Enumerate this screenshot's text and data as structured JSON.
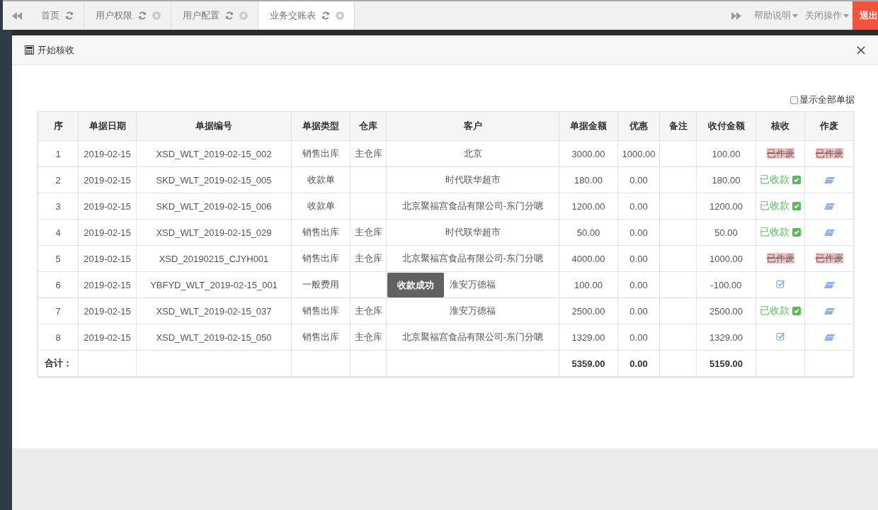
{
  "tabs": [
    {
      "label": "首页",
      "closable": false,
      "selected": false
    },
    {
      "label": "用户权限",
      "closable": true,
      "selected": false
    },
    {
      "label": "用户配置",
      "closable": true,
      "selected": false
    },
    {
      "label": "业务交账表",
      "closable": true,
      "selected": true
    }
  ],
  "top_menus": [
    "帮助说明",
    "关闭操作"
  ],
  "logout": "退出",
  "dialog": {
    "title": "开始核收",
    "show_all": {
      "label": "显示全部单据",
      "checked": false
    },
    "table": {
      "columns": [
        "序",
        "单据日期",
        "单据编号",
        "单据类型",
        "仓库",
        "客户",
        "单据金额",
        "优惠",
        "备注",
        "收付金额",
        "核收",
        "作废"
      ],
      "rows": [
        {
          "no": "1",
          "date": "2019-02-15",
          "code": "XSD_WLT_2019-02-15_002",
          "type": "销售出库",
          "warehouse": "主仓库",
          "customer": "北京",
          "amount": "3000.00",
          "discount": "1000.00",
          "paid": "100.00",
          "check": {
            "kind": "voided",
            "label": "已作废"
          },
          "void": {
            "kind": "voided",
            "label": "已作废"
          }
        },
        {
          "no": "2",
          "date": "2019-02-15",
          "code": "SKD_WLT_2019-02-15_005",
          "type": "收款单",
          "warehouse": "",
          "customer": "时代联华超市",
          "amount": "180.00",
          "discount": "0.00",
          "paid": "180.00",
          "check": {
            "kind": "received",
            "label": "已收款"
          },
          "void": {
            "kind": "eraser"
          }
        },
        {
          "no": "3",
          "date": "2019-02-15",
          "code": "SKD_WLT_2019-02-15_006",
          "type": "收款单",
          "warehouse": "",
          "customer": "北京聚福宫食品有限公司-东门分嗯",
          "amount": "1200.00",
          "discount": "0.00",
          "paid": "1200.00",
          "check": {
            "kind": "received",
            "label": "已收款"
          },
          "void": {
            "kind": "eraser"
          }
        },
        {
          "no": "4",
          "date": "2019-02-15",
          "code": "XSD_WLT_2019-02-15_029",
          "type": "销售出库",
          "warehouse": "主仓库",
          "customer": "时代联华超市",
          "amount": "50.00",
          "discount": "0.00",
          "paid": "50.00",
          "check": {
            "kind": "received",
            "label": "已收款"
          },
          "void": {
            "kind": "eraser"
          }
        },
        {
          "no": "5",
          "date": "2019-02-15",
          "code": "XSD_20190215_CJYH001",
          "type": "销售出库",
          "warehouse": "主仓库",
          "customer": "北京聚福宫食品有限公司-东门分嗯",
          "amount": "4000.00",
          "discount": "0.00",
          "paid": "1000.00",
          "check": {
            "kind": "voided",
            "label": "已作废"
          },
          "void": {
            "kind": "voided",
            "label": "已作废"
          }
        },
        {
          "no": "6",
          "date": "2019-02-15",
          "code": "YBFYD_WLT_2019-02-15_001",
          "type": "一般费用",
          "warehouse": "",
          "customer": "淮安万德福",
          "amount": "100.00",
          "discount": "0.00",
          "paid": "-100.00",
          "check": {
            "kind": "pending"
          },
          "void": {
            "kind": "eraser"
          }
        },
        {
          "no": "7",
          "date": "2019-02-15",
          "code": "XSD_WLT_2019-02-15_037",
          "type": "销售出库",
          "warehouse": "主仓库",
          "customer": "淮安万德福",
          "amount": "2500.00",
          "discount": "0.00",
          "paid": "2500.00",
          "check": {
            "kind": "received",
            "label": "已收款"
          },
          "void": {
            "kind": "eraser"
          }
        },
        {
          "no": "8",
          "date": "2019-02-15",
          "code": "XSD_WLT_2019-02-15_050",
          "type": "销售出库",
          "warehouse": "主仓库",
          "customer": "北京聚福宫食品有限公司-东门分嗯",
          "amount": "1329.00",
          "discount": "0.00",
          "paid": "1329.00",
          "check": {
            "kind": "pending"
          },
          "void": {
            "kind": "eraser"
          }
        }
      ],
      "total": {
        "label": "合计：",
        "amount": "5359.00",
        "discount": "0.00",
        "paid": "5159.00"
      }
    },
    "toast": "收款成功"
  }
}
